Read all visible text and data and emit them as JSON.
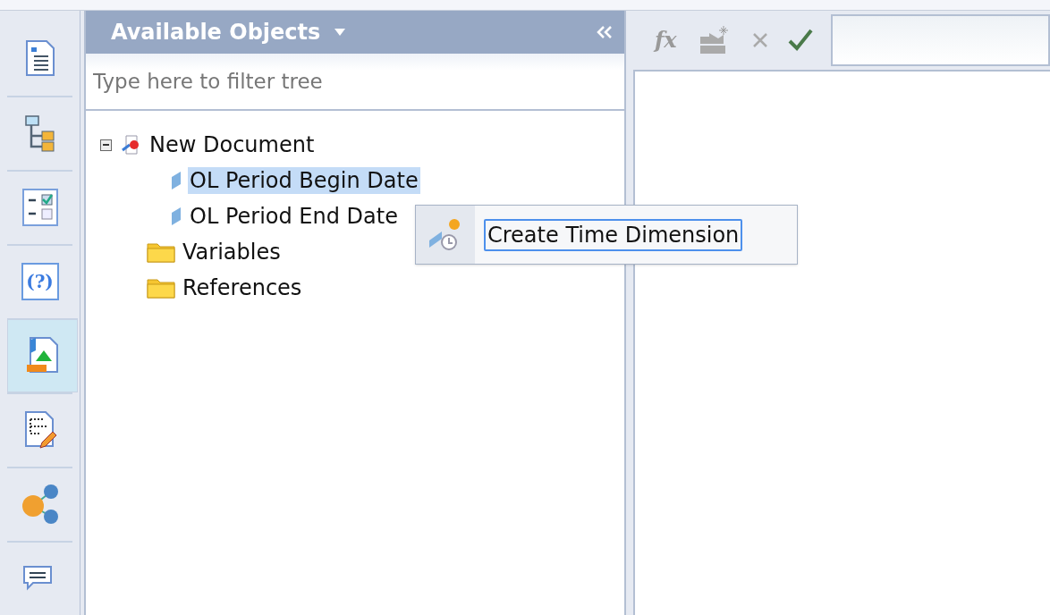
{
  "sidebar": {
    "items": [
      {
        "kind": "document",
        "selected": false
      },
      {
        "kind": "tree",
        "selected": false
      },
      {
        "kind": "checklist",
        "selected": false
      },
      {
        "kind": "question",
        "label": "(?)",
        "selected": false
      },
      {
        "kind": "chart-doc",
        "selected": true
      },
      {
        "kind": "edit-doc",
        "selected": false
      },
      {
        "kind": "share",
        "selected": false
      },
      {
        "kind": "comment",
        "selected": false
      }
    ]
  },
  "panel": {
    "title": "Available Objects",
    "filter": {
      "placeholder": "Type here to filter tree"
    },
    "tree": [
      {
        "label": "New Document",
        "kind": "document",
        "expanded": true,
        "selected": false,
        "children": [
          {
            "label": "OL Period Begin Date",
            "kind": "dimension",
            "selected": true
          },
          {
            "label": "OL Period End Date",
            "kind": "dimension",
            "selected": false
          },
          {
            "label": "Variables",
            "kind": "folder",
            "selected": false
          },
          {
            "label": "References",
            "kind": "folder",
            "selected": false
          }
        ]
      }
    ]
  },
  "toolbar": {
    "formula_label": "fx"
  },
  "context_menu": {
    "items": [
      {
        "label": "Create Time Dimension",
        "selected": true
      }
    ]
  }
}
